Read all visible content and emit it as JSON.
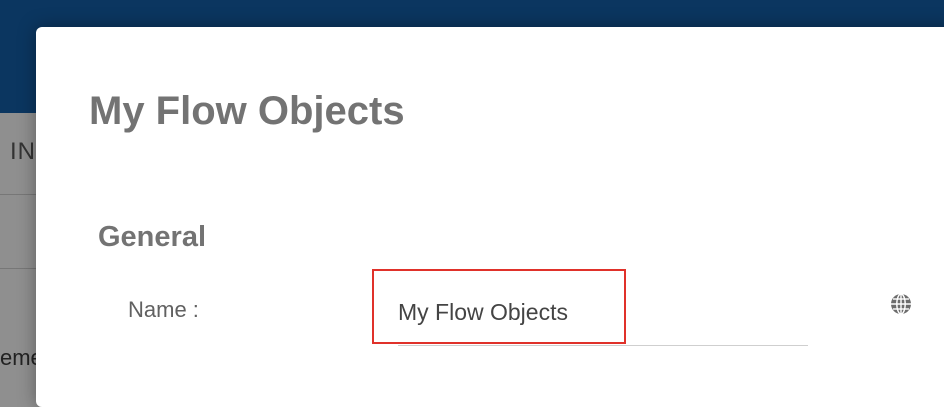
{
  "background": {
    "tab_label": "IN",
    "text_fragment": "eme"
  },
  "dialog": {
    "title": "My Flow Objects",
    "section": "General",
    "name_label": "Name :",
    "name_value": "My Flow Objects",
    "language_icon": "globe-icon"
  },
  "colors": {
    "header": "#0b3660",
    "highlight": "#e0312a",
    "title_text": "#737373"
  }
}
